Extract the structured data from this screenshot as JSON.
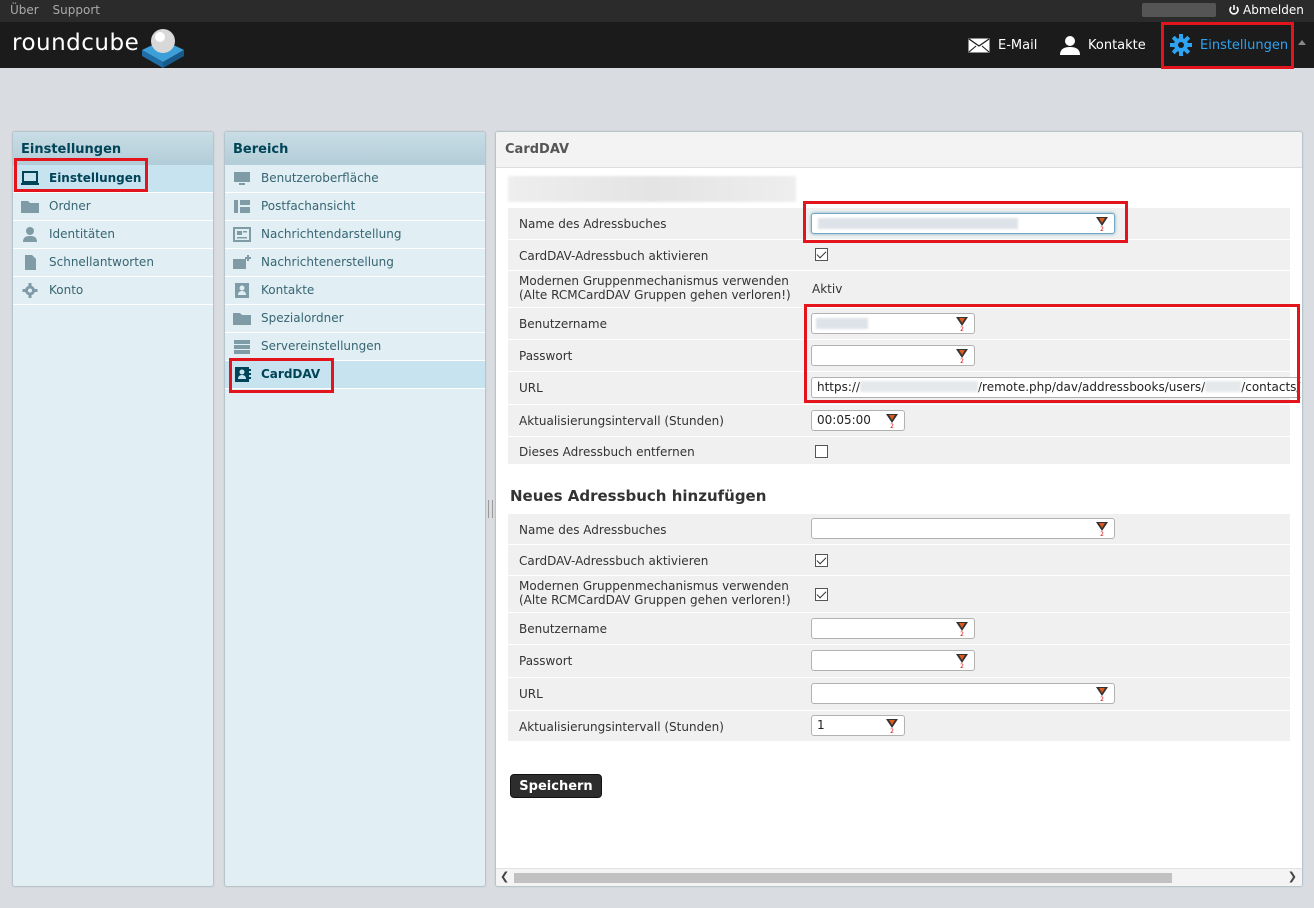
{
  "topbar": {
    "about": "Über",
    "support": "Support",
    "logout": "Abmelden"
  },
  "header": {
    "logo": "roundcube",
    "nav": {
      "email": "E-Mail",
      "contacts": "Kontakte",
      "settings": "Einstellungen"
    }
  },
  "left_panel": {
    "title": "Einstellungen",
    "items": [
      {
        "label": "Einstellungen",
        "icon": "monitor-icon",
        "selected": true
      },
      {
        "label": "Ordner",
        "icon": "folder-icon"
      },
      {
        "label": "Identitäten",
        "icon": "person-icon"
      },
      {
        "label": "Schnellantworten",
        "icon": "document-icon"
      },
      {
        "label": "Konto",
        "icon": "gear-icon"
      }
    ]
  },
  "mid_panel": {
    "title": "Bereich",
    "items": [
      {
        "label": "Benutzeroberfläche",
        "icon": "monitor-icon"
      },
      {
        "label": "Postfachansicht",
        "icon": "layout-icon"
      },
      {
        "label": "Nachrichtendarstellung",
        "icon": "newspaper-icon"
      },
      {
        "label": "Nachrichtenerstellung",
        "icon": "mail-plus-icon"
      },
      {
        "label": "Kontakte",
        "icon": "contact-card-icon"
      },
      {
        "label": "Spezialordner",
        "icon": "folder-icon"
      },
      {
        "label": "Servereinstellungen",
        "icon": "server-icon"
      },
      {
        "label": "CardDAV",
        "icon": "address-book-icon",
        "selected": true
      }
    ]
  },
  "main": {
    "title": "CardDAV",
    "existing": {
      "name_label": "Name des Adressbuches",
      "activate_label": "CardDAV-Adressbuch aktivieren",
      "activate_checked": true,
      "group_label_1": "Modernen Gruppenmechanismus verwenden",
      "group_label_2": "(Alte RCMCardDAV Gruppen gehen verloren!)",
      "group_value": "Aktiv",
      "username_label": "Benutzername",
      "password_label": "Passwort",
      "url_label": "URL",
      "url_prefix": "https://",
      "url_mid": "/remote.php/dav/addressbooks/users/",
      "url_suffix": "/contacts/",
      "interval_label": "Aktualisierungsintervall (Stunden)",
      "interval_value": "00:05:00",
      "remove_label": "Dieses Adressbuch entfernen",
      "remove_checked": false
    },
    "new_section_title": "Neues Adressbuch hinzufügen",
    "new": {
      "name_label": "Name des Adressbuches",
      "activate_label": "CardDAV-Adressbuch aktivieren",
      "activate_checked": true,
      "group_label_1": "Modernen Gruppenmechanismus verwenden",
      "group_label_2": "(Alte RCMCardDAV Gruppen gehen verloren!)",
      "group_checked": true,
      "username_label": "Benutzername",
      "password_label": "Passwort",
      "url_label": "URL",
      "interval_label": "Aktualisierungsintervall (Stunden)",
      "interval_value": "1"
    },
    "save_label": "Speichern"
  },
  "colors": {
    "accent": "#2ea3f2",
    "highlight": "#e4141c",
    "header_bg": "#1b1b1b"
  }
}
